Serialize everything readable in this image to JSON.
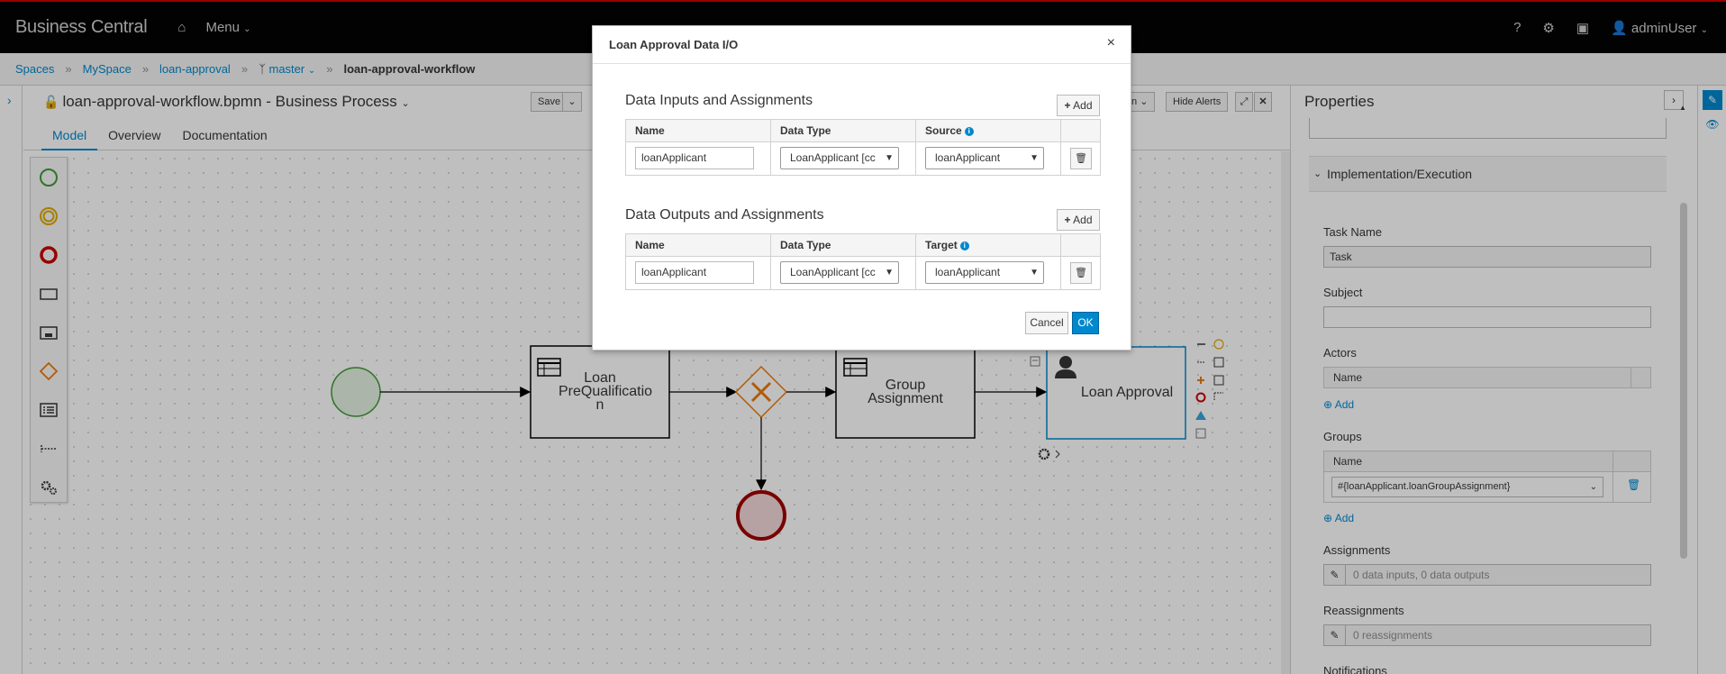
{
  "topbar": {
    "brand": "Business Central",
    "menu_label": "Menu",
    "help": "?",
    "user": "adminUser"
  },
  "breadcrumb": {
    "items": [
      "Spaces",
      "MySpace",
      "loan-approval",
      "master"
    ],
    "current": "loan-approval-workflow"
  },
  "editor": {
    "title": "loan-approval-workflow.bpmn - Business Process",
    "save_label": "Save",
    "hide_alerts_label": "Hide Alerts",
    "partial_label": "n",
    "tabs": [
      "Model",
      "Overview",
      "Documentation"
    ]
  },
  "diagram": {
    "task1": "Loan PreQualificatio n",
    "task2": "Group Assignment",
    "task3": "Loan Approval"
  },
  "properties": {
    "title": "Properties",
    "section": "Implementation/Execution",
    "task_name_label": "Task Name",
    "task_name_value": "Task",
    "subject_label": "Subject",
    "actors_label": "Actors",
    "actors_col": "Name",
    "add_label": "Add",
    "groups_label": "Groups",
    "groups_col": "Name",
    "groups_value": "#{loanApplicant.loanGroupAssignment}",
    "assignments_label": "Assignments",
    "assignments_value": "0 data inputs, 0 data outputs",
    "reassignments_label": "Reassignments",
    "reassignments_value": "0 reassignments",
    "notifications_label": "Notifications"
  },
  "modal": {
    "title": "Loan Approval Data I/O",
    "close": "×",
    "inputs": {
      "title": "Data Inputs and Assignments",
      "add_label": "Add",
      "col_name": "Name",
      "col_type": "Data Type",
      "col_source": "Source",
      "row": {
        "name": "loanApplicant",
        "type": "LoanApplicant [cc",
        "source": "loanApplicant"
      }
    },
    "outputs": {
      "title": "Data Outputs and Assignments",
      "add_label": "Add",
      "col_name": "Name",
      "col_type": "Data Type",
      "col_target": "Target",
      "row": {
        "name": "loanApplicant",
        "type": "LoanApplicant [cc",
        "target": "loanApplicant"
      }
    },
    "cancel_label": "Cancel",
    "ok_label": "OK"
  }
}
